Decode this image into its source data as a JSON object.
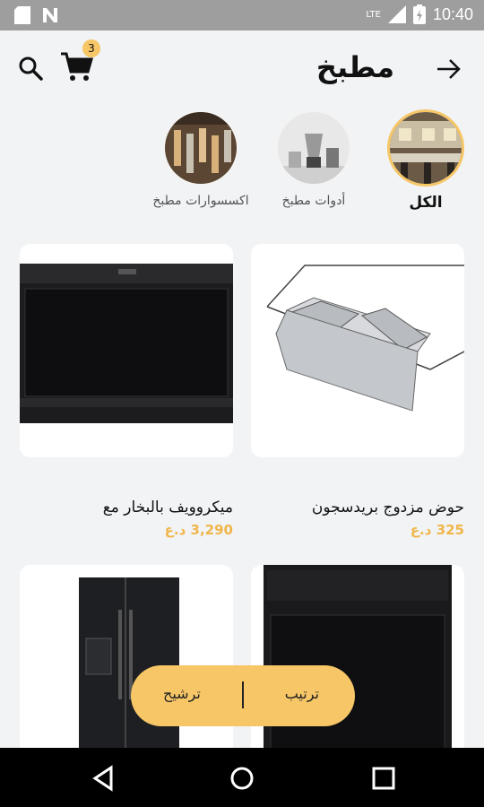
{
  "status_bar": {
    "time": "10:40",
    "network_label": "LTE",
    "icons": [
      "sd-card-icon",
      "n-icon",
      "signal-icon",
      "battery-icon"
    ]
  },
  "header": {
    "title": "مطبخ",
    "cart_count": "3",
    "icons": [
      "search-icon",
      "cart-icon",
      "back-arrow-icon"
    ]
  },
  "categories": [
    {
      "label": "الكل",
      "active": true
    },
    {
      "label": "أدوات مطبخ",
      "active": false
    },
    {
      "label": "اكسسوارات مطبخ",
      "active": false
    }
  ],
  "products": [
    {
      "name": "حوض مزدوج بريدسجون",
      "price": "325 د.ع"
    },
    {
      "name": "ميكروويف بالبخار مع",
      "price": "3,290 د.ع"
    },
    {
      "name": "",
      "price": ""
    },
    {
      "name": "",
      "price": ""
    }
  ],
  "fab": {
    "sort_label": "ترتيب",
    "filter_label": "ترشيح"
  },
  "colors": {
    "accent": "#f6c667",
    "price": "#f0b64a",
    "background": "#f2f3f5",
    "status_bar": "#9e9e9e"
  }
}
